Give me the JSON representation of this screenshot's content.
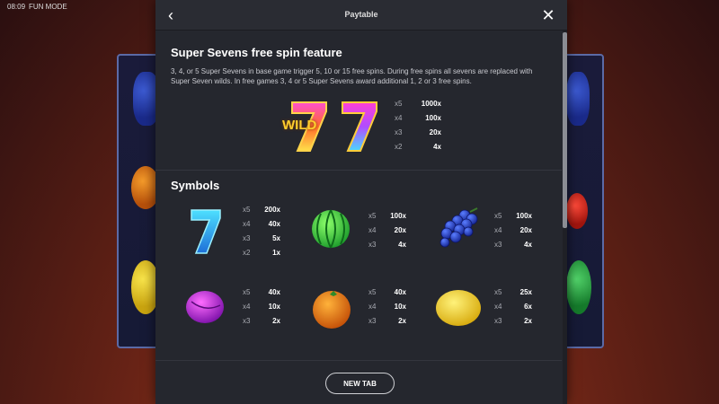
{
  "status": {
    "time": "08:09",
    "mode": "FUN MODE"
  },
  "header": {
    "title": "Paytable"
  },
  "feature": {
    "title": "Super Sevens free spin feature",
    "description": "3, 4, or 5 Super Sevens in base game trigger 5, 10 or 15 free spins. During free spins all sevens are replaced with Super Seven wilds. In free games 3, 4 or 5 Super Sevens award additional 1, 2 or 3 free spins.",
    "wild_label": "WILD",
    "pays": [
      {
        "count": "x5",
        "mult": "1000x"
      },
      {
        "count": "x4",
        "mult": "100x"
      },
      {
        "count": "x3",
        "mult": "20x"
      },
      {
        "count": "x2",
        "mult": "4x"
      }
    ]
  },
  "symbols": {
    "title": "Symbols",
    "items": [
      {
        "icon": "blue-seven-icon",
        "pays": [
          {
            "count": "x5",
            "mult": "200x"
          },
          {
            "count": "x4",
            "mult": "40x"
          },
          {
            "count": "x3",
            "mult": "5x"
          },
          {
            "count": "x2",
            "mult": "1x"
          }
        ]
      },
      {
        "icon": "watermelon-icon",
        "pays": [
          {
            "count": "x5",
            "mult": "100x"
          },
          {
            "count": "x4",
            "mult": "20x"
          },
          {
            "count": "x3",
            "mult": "4x"
          }
        ]
      },
      {
        "icon": "grapes-icon",
        "pays": [
          {
            "count": "x5",
            "mult": "100x"
          },
          {
            "count": "x4",
            "mult": "20x"
          },
          {
            "count": "x3",
            "mult": "4x"
          }
        ]
      },
      {
        "icon": "plum-icon",
        "pays": [
          {
            "count": "x5",
            "mult": "40x"
          },
          {
            "count": "x4",
            "mult": "10x"
          },
          {
            "count": "x3",
            "mult": "2x"
          }
        ]
      },
      {
        "icon": "orange-icon",
        "pays": [
          {
            "count": "x5",
            "mult": "40x"
          },
          {
            "count": "x4",
            "mult": "10x"
          },
          {
            "count": "x3",
            "mult": "2x"
          }
        ]
      },
      {
        "icon": "lemon-icon",
        "pays": [
          {
            "count": "x5",
            "mult": "25x"
          },
          {
            "count": "x4",
            "mult": "6x"
          },
          {
            "count": "x3",
            "mult": "2x"
          }
        ]
      }
    ]
  },
  "footer": {
    "new_tab_label": "NEW TAB"
  },
  "colors": {
    "panel": "#25272e",
    "header": "#2a2c33",
    "accent_text": "#ffffff"
  }
}
